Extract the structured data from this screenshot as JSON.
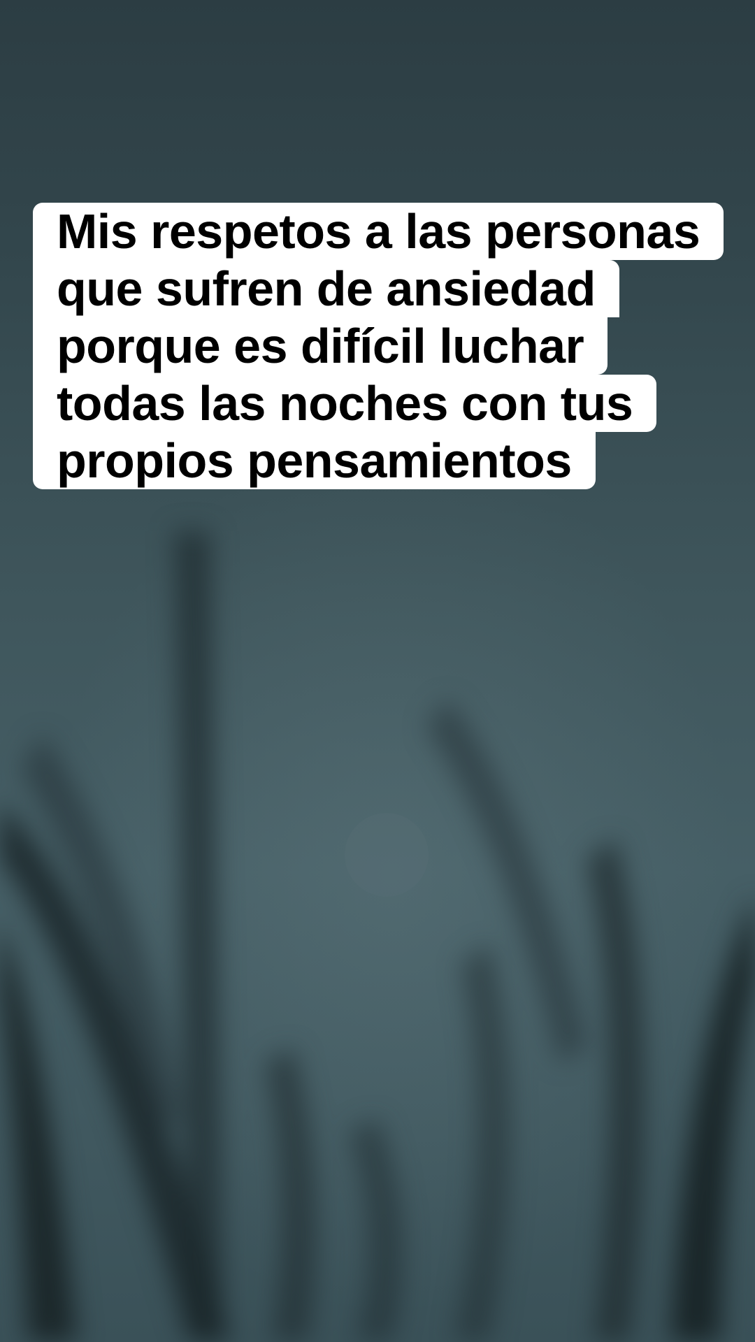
{
  "caption": {
    "lines": [
      "Mis respetos a las personas",
      "que sufren de ansiedad",
      "porque es difícil luchar",
      "todas las noches con tus",
      "propios pensamientos"
    ]
  },
  "colors": {
    "caption_background": "#ffffff",
    "caption_text": "#000000",
    "sky_top": "#2c3d43",
    "sky_bottom": "#3a5158",
    "moon": "#f1efe8"
  },
  "scene": {
    "subject_icons": [
      "crescent-moon-icon",
      "grass-blades"
    ]
  }
}
